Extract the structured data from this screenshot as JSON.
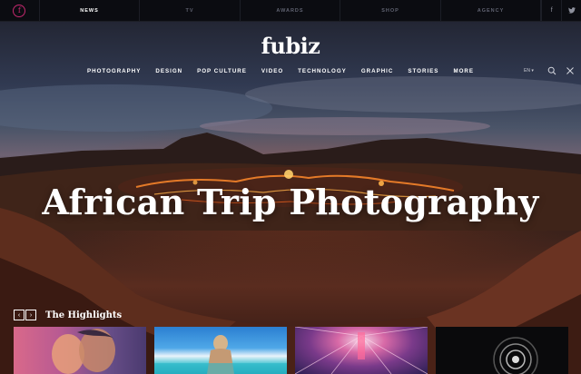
{
  "topbar": {
    "logo_letter": "f",
    "sections": [
      "NEWS",
      "TV",
      "AWARDS",
      "SHOP",
      "AGENCY"
    ],
    "active_section": "NEWS",
    "social": [
      "facebook-icon",
      "twitter-icon"
    ],
    "social_glyphs": [
      "f",
      "t"
    ]
  },
  "brand": {
    "name": "fubiz"
  },
  "mainnav": {
    "items": [
      "PHOTOGRAPHY",
      "DESIGN",
      "POP CULTURE",
      "VIDEO",
      "TECHNOLOGY",
      "GRAPHIC",
      "STORIES",
      "MORE"
    ],
    "lang": "EN ▾",
    "icons": [
      "search-icon",
      "close-icon"
    ]
  },
  "hero": {
    "headline": "African Trip Photography"
  },
  "highlights": {
    "title": "The Highlights",
    "prev_glyph": "‹",
    "next_glyph": "›"
  },
  "cards": [
    {
      "subject": "couple-portrait"
    },
    {
      "subject": "woman-at-pool"
    },
    {
      "subject": "light-tunnel"
    },
    {
      "subject": "eye-spiral"
    }
  ],
  "colors": {
    "accent": "#c4286e",
    "topbar_bg": "#0b0c11",
    "lava": "#ff7a2a"
  }
}
